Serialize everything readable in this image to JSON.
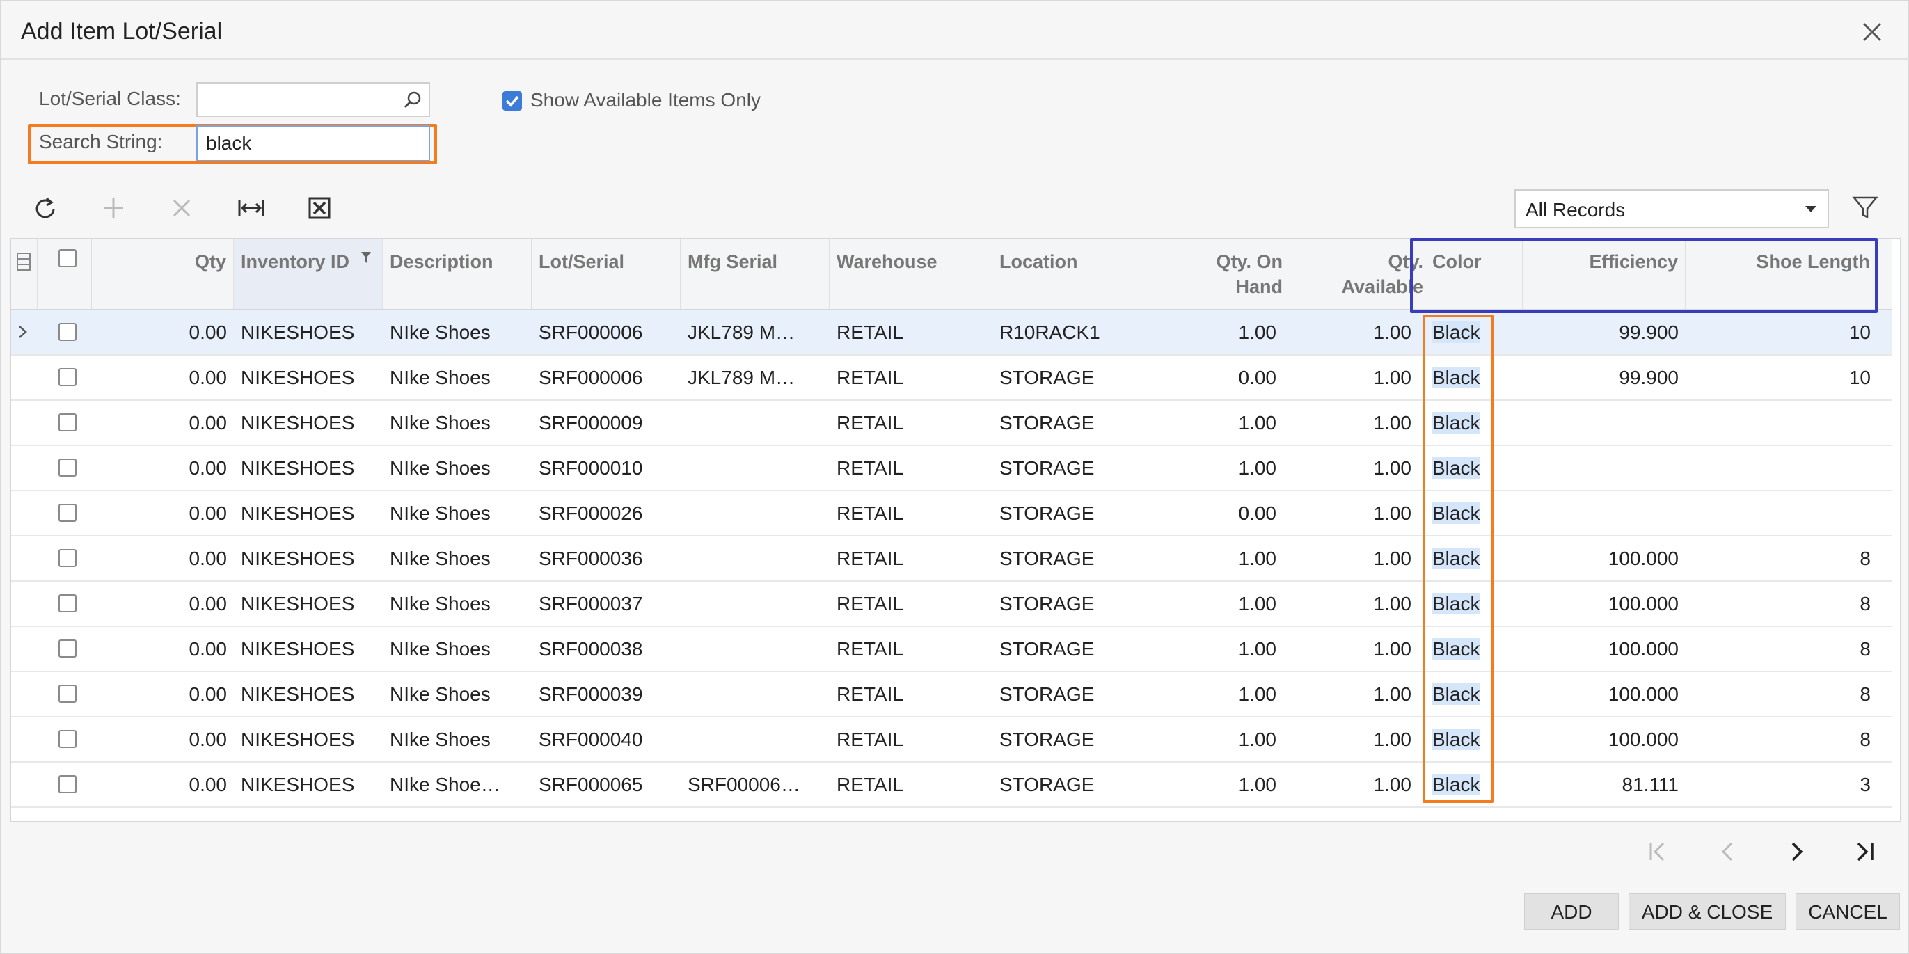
{
  "dialog": {
    "title": "Add Item Lot/Serial"
  },
  "filters": {
    "lot_serial_class_label": "Lot/Serial Class:",
    "lot_serial_class_value": "",
    "search_string_label": "Search String:",
    "search_string_value": "black",
    "show_available_label": "Show Available Items Only",
    "show_available_checked": true
  },
  "toolbar": {
    "records_filter": "All Records"
  },
  "grid": {
    "columns": {
      "qty": "Qty",
      "inventory_id": "Inventory ID",
      "description": "Description",
      "lot_serial": "Lot/Serial",
      "mfg_serial": "Mfg Serial",
      "warehouse": "Warehouse",
      "location": "Location",
      "qty_on_hand_1": "Qty. On",
      "qty_on_hand_2": "Hand",
      "qty_available_1": "Qty.",
      "qty_available_2": "Available",
      "color": "Color",
      "efficiency": "Efficiency",
      "shoe_length": "Shoe Length"
    },
    "rows": [
      {
        "qty": "0.00",
        "inventory_id": "NIKESHOES",
        "description": "NIke Shoes",
        "lot_serial": "SRF000006",
        "mfg_serial": "JKL789 M…",
        "warehouse": "RETAIL",
        "location": "R10RACK1",
        "qty_on_hand": "1.00",
        "qty_available": "1.00",
        "color": "Black",
        "efficiency": "99.900",
        "shoe_length": "10"
      },
      {
        "qty": "0.00",
        "inventory_id": "NIKESHOES",
        "description": "NIke Shoes",
        "lot_serial": "SRF000006",
        "mfg_serial": "JKL789 M…",
        "warehouse": "RETAIL",
        "location": "STORAGE",
        "qty_on_hand": "0.00",
        "qty_available": "1.00",
        "color": "Black",
        "efficiency": "99.900",
        "shoe_length": "10"
      },
      {
        "qty": "0.00",
        "inventory_id": "NIKESHOES",
        "description": "NIke Shoes",
        "lot_serial": "SRF000009",
        "mfg_serial": "",
        "warehouse": "RETAIL",
        "location": "STORAGE",
        "qty_on_hand": "1.00",
        "qty_available": "1.00",
        "color": "Black",
        "efficiency": "",
        "shoe_length": ""
      },
      {
        "qty": "0.00",
        "inventory_id": "NIKESHOES",
        "description": "NIke Shoes",
        "lot_serial": "SRF000010",
        "mfg_serial": "",
        "warehouse": "RETAIL",
        "location": "STORAGE",
        "qty_on_hand": "1.00",
        "qty_available": "1.00",
        "color": "Black",
        "efficiency": "",
        "shoe_length": ""
      },
      {
        "qty": "0.00",
        "inventory_id": "NIKESHOES",
        "description": "NIke Shoes",
        "lot_serial": "SRF000026",
        "mfg_serial": "",
        "warehouse": "RETAIL",
        "location": "STORAGE",
        "qty_on_hand": "0.00",
        "qty_available": "1.00",
        "color": "Black",
        "efficiency": "",
        "shoe_length": ""
      },
      {
        "qty": "0.00",
        "inventory_id": "NIKESHOES",
        "description": "NIke Shoes",
        "lot_serial": "SRF000036",
        "mfg_serial": "",
        "warehouse": "RETAIL",
        "location": "STORAGE",
        "qty_on_hand": "1.00",
        "qty_available": "1.00",
        "color": "Black",
        "efficiency": "100.000",
        "shoe_length": "8"
      },
      {
        "qty": "0.00",
        "inventory_id": "NIKESHOES",
        "description": "NIke Shoes",
        "lot_serial": "SRF000037",
        "mfg_serial": "",
        "warehouse": "RETAIL",
        "location": "STORAGE",
        "qty_on_hand": "1.00",
        "qty_available": "1.00",
        "color": "Black",
        "efficiency": "100.000",
        "shoe_length": "8"
      },
      {
        "qty": "0.00",
        "inventory_id": "NIKESHOES",
        "description": "NIke Shoes",
        "lot_serial": "SRF000038",
        "mfg_serial": "",
        "warehouse": "RETAIL",
        "location": "STORAGE",
        "qty_on_hand": "1.00",
        "qty_available": "1.00",
        "color": "Black",
        "efficiency": "100.000",
        "shoe_length": "8"
      },
      {
        "qty": "0.00",
        "inventory_id": "NIKESHOES",
        "description": "NIke Shoes",
        "lot_serial": "SRF000039",
        "mfg_serial": "",
        "warehouse": "RETAIL",
        "location": "STORAGE",
        "qty_on_hand": "1.00",
        "qty_available": "1.00",
        "color": "Black",
        "efficiency": "100.000",
        "shoe_length": "8"
      },
      {
        "qty": "0.00",
        "inventory_id": "NIKESHOES",
        "description": "NIke Shoes",
        "lot_serial": "SRF000040",
        "mfg_serial": "",
        "warehouse": "RETAIL",
        "location": "STORAGE",
        "qty_on_hand": "1.00",
        "qty_available": "1.00",
        "color": "Black",
        "efficiency": "100.000",
        "shoe_length": "8"
      },
      {
        "qty": "0.00",
        "inventory_id": "NIKESHOES",
        "description": "NIke Shoe…",
        "lot_serial": "SRF000065",
        "mfg_serial": "SRF00006…",
        "warehouse": "RETAIL",
        "location": "STORAGE",
        "qty_on_hand": "1.00",
        "qty_available": "1.00",
        "color": "Black",
        "efficiency": "81.111",
        "shoe_length": "3"
      }
    ]
  },
  "footer": {
    "add_label": "ADD",
    "add_close_label": "ADD & CLOSE",
    "cancel_label": "CANCEL"
  },
  "colors": {
    "annotation_orange": "#f47c20",
    "annotation_blue": "#3a3dbb",
    "checkbox_accent": "#3d7bd9"
  }
}
